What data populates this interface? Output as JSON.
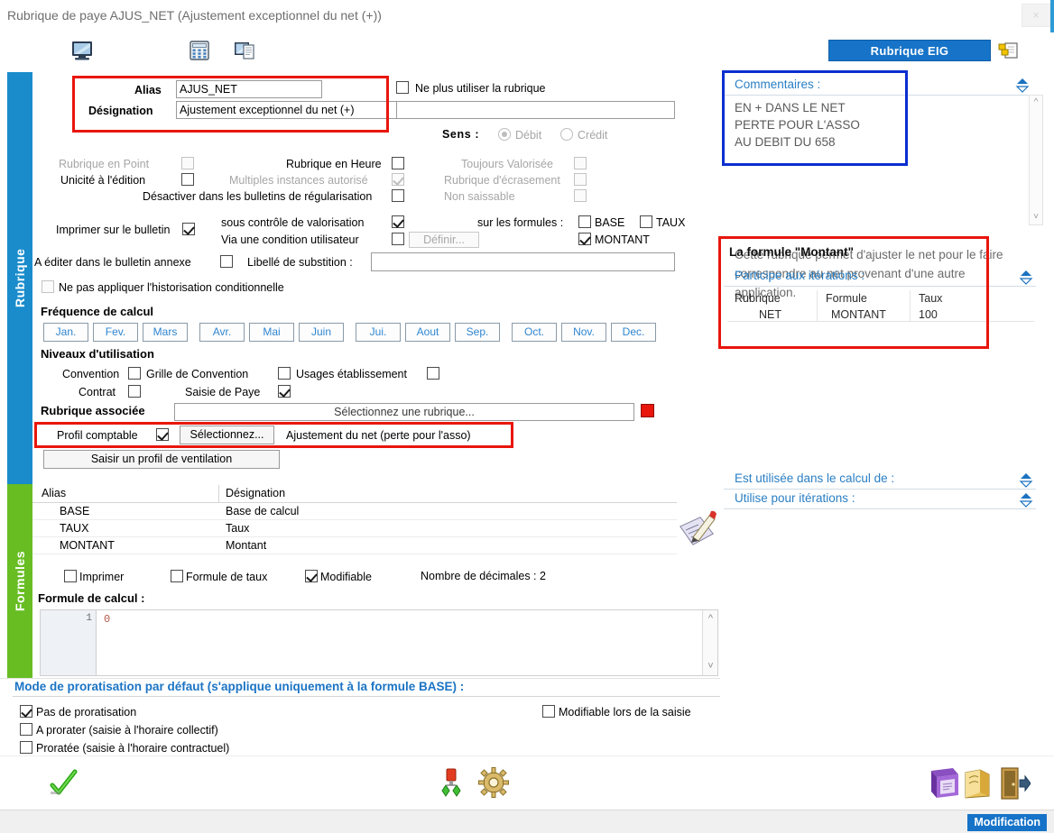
{
  "window": {
    "title": "Rubrique de paye AJUS_NET (Ajustement exceptionnel du net (+))",
    "close_label": "×"
  },
  "toolbar": {
    "icons": [
      {
        "name": "monitor-icon",
        "label": "Affichage"
      },
      {
        "name": "calculator-icon",
        "label": "Calculatrice"
      },
      {
        "name": "duplicate-icon",
        "label": "Dupliquer"
      }
    ],
    "eig_button": "Rubrique EIG",
    "eig_copy_icon": "copy-pages-icon"
  },
  "tabs": [
    {
      "id": "rubrique",
      "label": "Rubrique",
      "color": "#1a8ccc"
    },
    {
      "id": "formules",
      "label": "Formules",
      "color": "#67bd22"
    }
  ],
  "identity": {
    "alias_label": "Alias",
    "alias_value": "AJUS_NET",
    "designation_label": "Désignation",
    "designation_value": "Ajustement exceptionnel du net (+)",
    "unused_checkbox": "Ne plus utiliser la rubrique",
    "secondary_value": ""
  },
  "sens": {
    "label": "Sens :",
    "options": [
      "Débit",
      "Crédit"
    ],
    "selected": "Débit"
  },
  "options": {
    "col1": [
      {
        "label": "Rubrique en Point",
        "checked": false,
        "disabled": true
      },
      {
        "label": "Unicité à l'édition",
        "checked": false,
        "disabled": false
      }
    ],
    "col2": [
      {
        "label": "Rubrique en Heure",
        "checked": false,
        "disabled": false
      },
      {
        "label": "Multiples instances autorisé",
        "checked": true,
        "disabled": true
      }
    ],
    "col3": [
      {
        "label": "Toujours Valorisée",
        "checked": false,
        "disabled": true
      },
      {
        "label": "Rubrique d'écrasement",
        "checked": false,
        "disabled": true
      },
      {
        "label": "Non saissable",
        "checked": false,
        "disabled": true
      }
    ],
    "deactivate": {
      "label": "Désactiver dans les bulletins de régularisation",
      "checked": false
    }
  },
  "printing": {
    "print_bulletin": {
      "label": "Imprimer sur le bulletin",
      "checked": true
    },
    "valorisation": {
      "label": "sous contrôle de valorisation",
      "checked": true
    },
    "user_condition": {
      "label": "Via une condition utilisateur",
      "checked": false
    },
    "define_button": "Définir...",
    "formulas_label": "sur les formules :",
    "formulas": [
      {
        "label": "BASE",
        "checked": false
      },
      {
        "label": "TAUX",
        "checked": false
      },
      {
        "label": "MONTANT",
        "checked": true
      }
    ],
    "annexe": {
      "label": "A éditer dans le bulletin annexe",
      "checked": false
    },
    "substitution_label": "Libellé de substition :",
    "substitution_value": "",
    "historisation": {
      "label": "Ne pas appliquer l'historisation conditionnelle",
      "checked": false,
      "disabled": true
    }
  },
  "frequency": {
    "title": "Fréquence de calcul",
    "months": [
      "Jan.",
      "Fev.",
      "Mars",
      "Avr.",
      "Mai",
      "Juin",
      "Jui.",
      "Aout",
      "Sep.",
      "Oct.",
      "Nov.",
      "Dec."
    ]
  },
  "levels": {
    "title": "Niveaux d'utilisation",
    "items": [
      {
        "label": "Convention",
        "checked": false
      },
      {
        "label": "Grille de Convention",
        "checked": false
      },
      {
        "label": "Usages établissement",
        "checked": false
      },
      {
        "label": "Contrat",
        "checked": false
      },
      {
        "label": "Saisie de Paye",
        "checked": true
      }
    ],
    "associated_label": "Rubrique associée",
    "associated_value": "Sélectionnez une rubrique...",
    "clear_icon": "red-square-icon"
  },
  "accounting": {
    "profile_label": "Profil comptable",
    "profile_checked": true,
    "select_button": "Sélectionnez...",
    "profile_value": "Ajustement du net (perte pour l'asso)",
    "ventilation_button": "Saisir un profil de ventilation"
  },
  "formulas_grid": {
    "headers": [
      "Alias",
      "Désignation"
    ],
    "rows": [
      {
        "alias": "BASE",
        "designation": "Base de calcul"
      },
      {
        "alias": "TAUX",
        "designation": "Taux"
      },
      {
        "alias": "MONTANT",
        "designation": "Montant"
      }
    ],
    "edit_icon": "pencil-notepad-icon",
    "flags": [
      {
        "label": "Imprimer",
        "checked": false
      },
      {
        "label": "Formule de taux",
        "checked": false
      },
      {
        "label": "Modifiable",
        "checked": true
      }
    ],
    "decimals_label": "Nombre de décimales : 2",
    "formula_label": "Formule de calcul :",
    "editor_line_number": "1",
    "editor_code": "0"
  },
  "proratisation": {
    "title": "Mode de proratisation par défaut (s'applique uniquement à la formule BASE) :",
    "options": [
      {
        "label": "Pas de proratisation",
        "checked": true
      },
      {
        "label": "A prorater (saisie à l'horaire collectif)",
        "checked": false
      },
      {
        "label": "Proratée (saisie à l'horaire contractuel)",
        "checked": false
      }
    ],
    "editable_on_entry": {
      "label": "Modifiable lors de la saisie",
      "checked": false
    }
  },
  "right_panel": {
    "comments_header": "Commentaires :",
    "comments_body": "EN + DANS LE NET\nPERTE POUR L'ASSO\nAU DEBIT DU 658",
    "description": "Cette rubrique permet d'ajuster le net pour le faire correspondre au net provenant d'une autre application.",
    "formula_title": "La formule \"Montant\"",
    "iterations_header": "Participe aux itérations :",
    "iterations_table": {
      "headers": [
        "Rubrique",
        "Formule",
        "Taux"
      ],
      "rows": [
        {
          "rubrique": "NET",
          "formule": "MONTANT",
          "taux": "100"
        }
      ]
    },
    "used_in_header": "Est utilisée dans le calcul de :",
    "uses_for_header": "Utilise pour itérations :"
  },
  "bottom_toolbar": {
    "validate_icon": "green-check-icon",
    "tools_icon": "plug-connector-icon",
    "settings_icon": "gear-icon",
    "book_icon": "purple-book-icon",
    "folder_icon": "gold-folder-icon",
    "exit_icon": "exit-door-icon"
  },
  "statusbar": {
    "mode": "Modification"
  },
  "colors": {
    "accent_blue": "#1673c8",
    "tab_blue": "#1a8ccc",
    "tab_green": "#67bd22",
    "highlight_red": "#e8160c",
    "highlight_blue": "#0b2ecf",
    "link_blue": "#2a7fc4"
  }
}
